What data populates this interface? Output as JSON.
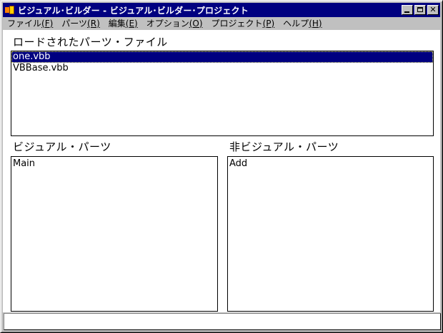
{
  "window": {
    "title": "ビジュアル･ビルダー - ビジュアル･ビルダー･プロジェクト"
  },
  "menubar": {
    "items": [
      {
        "label": "ファイル",
        "accel": "(F)"
      },
      {
        "label": "パーツ",
        "accel": "(R)"
      },
      {
        "label": "編集",
        "accel": "(E)"
      },
      {
        "label": "オプション",
        "accel": "(O)"
      },
      {
        "label": "プロジェクト",
        "accel": "(P)"
      },
      {
        "label": "ヘルプ",
        "accel": "(H)"
      }
    ]
  },
  "loaded_files": {
    "label": "ロードされたパーツ・ファイル",
    "items": [
      "one.vbb",
      "VBBase.vbb"
    ],
    "selected_index": 0
  },
  "visual_parts": {
    "label": "ビジュアル・パーツ",
    "items": [
      "Main"
    ]
  },
  "nonvisual_parts": {
    "label": "非ビジュアル・パーツ",
    "items": [
      "Add"
    ]
  },
  "statusbar": {
    "text": ""
  },
  "colors": {
    "titlebar": "#000080",
    "selection": "#000080",
    "chrome": "#c0c0c0"
  }
}
